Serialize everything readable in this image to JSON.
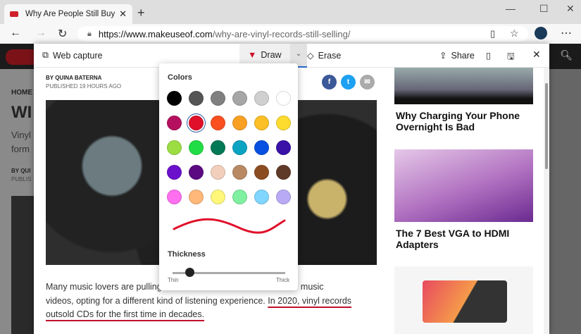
{
  "browser": {
    "tab_title": "Why Are People Still Buying Vinyl",
    "url_domain": "https://www.makeuseof.com",
    "url_path": "/why-are-vinyl-records-still-selling/"
  },
  "background_page": {
    "breadcrumb": "HOME",
    "title_fragment": "WI",
    "sub1": "Vinyl",
    "sub2": "form",
    "by": "BY QUI",
    "pub": "PUBLIS"
  },
  "capture_toolbar": {
    "web_capture": "Web capture",
    "draw": "Draw",
    "erase": "Erase",
    "share": "Share"
  },
  "article": {
    "author": "BY QUINA BATERNA",
    "published": "PUBLISHED 19 HOURS AGO",
    "para_line1_a": "Many music lovers are pulling",
    "para_line1_b": "d online music",
    "para_line2_a": "videos, opting for a different kind of listening experience. ",
    "para_line2_b": "In 2020, vinyl records",
    "para_line3": "outsold CDs for the first time in decades."
  },
  "sidebar": {
    "items": [
      {
        "title": "Why Charging Your Phone Overnight Is Bad"
      },
      {
        "title": "The 7 Best VGA to HDMI Adapters"
      }
    ]
  },
  "draw_popup": {
    "colors_label": "Colors",
    "thickness_label": "Thickness",
    "thin": "Thin",
    "thick": "Thick",
    "thickness_value": 0.15,
    "selected_color": "#e0102a",
    "colors": [
      "#000000",
      "#555555",
      "#808080",
      "#a6a6a6",
      "#d0d0d0",
      "#ffffff",
      "#b5105f",
      "#e0102a",
      "#fa4f1e",
      "#f9a023",
      "#fcbf24",
      "#fddb2f",
      "#9cdd44",
      "#21dd45",
      "#037a55",
      "#0aa3c2",
      "#0750e2",
      "#3a12a8",
      "#6b11cc",
      "#5c0a82",
      "#f2cfbd",
      "#b88963",
      "#8c4c22",
      "#603a28",
      "#ff6ff0",
      "#ffb87a",
      "#fff77a",
      "#7ff0a0",
      "#80d6ff",
      "#b9aaf5"
    ]
  }
}
